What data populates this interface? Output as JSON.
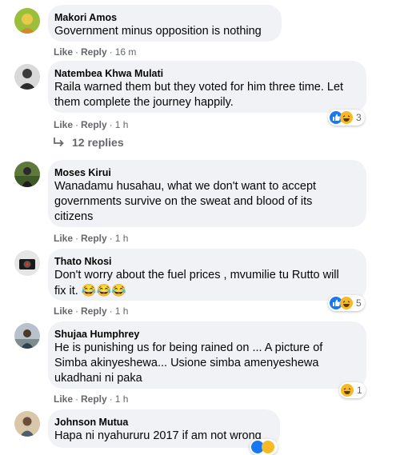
{
  "actions": {
    "like": "Like",
    "reply": "Reply"
  },
  "comments": [
    {
      "author": "Makori Amos",
      "text": "Government minus opposition is nothing",
      "time": "16 m"
    },
    {
      "author": "Natembea Khwa Mulati",
      "text": "Raila warned them but they voted for him three time. Let\nthem complete the journey happily.",
      "time": "1 h",
      "reaction_count": "3",
      "replies_label": "12 replies"
    },
    {
      "author": "Moses Kirui",
      "text": "Wanadamu husahau, what we don't want to accept\ngovernments survive on the sweat and blood of its\ncitizens",
      "time": "1 h"
    },
    {
      "author": "Thato Nkosi",
      "text": "Don't worry about the fuel prices , mvumilie tu Rutto will\nfix it.",
      "emoji": "😂😂😂",
      "time": "1 h",
      "reaction_count": "5"
    },
    {
      "author": "Shujaa Humphrey",
      "text": "He is punishing us for being rained on ... A picture of\nSimba akinyeshewa... Usione simba amenyeshewa\nukadhani ni paka",
      "time": "1 h",
      "reaction_count": "1"
    },
    {
      "author": "Johnson Mutua",
      "text": "Hapa ni nyahururu 2017 if am not wrong"
    }
  ],
  "colors": {
    "bubble": "#f0f2f5",
    "meta": "#65676b",
    "like_blue": "#1877f2",
    "haha_yellow": "#f7b928"
  },
  "icons": [
    "like-icon",
    "haha-icon",
    "reply-arrow-icon"
  ]
}
